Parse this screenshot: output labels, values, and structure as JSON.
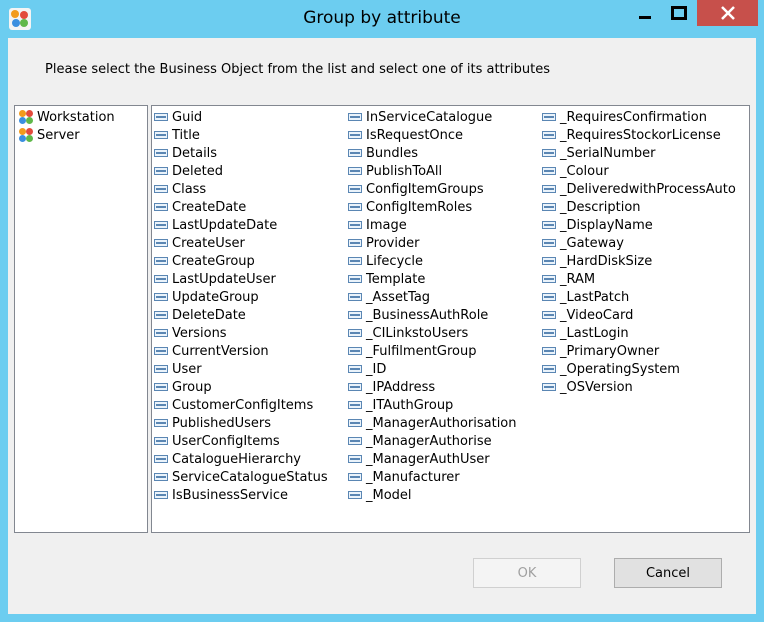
{
  "window": {
    "title": "Group by attribute",
    "colors": {
      "titlebar": "#6ccdf0",
      "close": "#c7504b"
    }
  },
  "instruction": "Please select the Business Object from the list and select one of its attributes",
  "business_objects": [
    {
      "label": "Workstation",
      "icon": "business-object-icon"
    },
    {
      "label": "Server",
      "icon": "business-object-icon"
    }
  ],
  "attributes": {
    "col1": [
      "Guid",
      "Title",
      "Details",
      "Deleted",
      "Class",
      "CreateDate",
      "LastUpdateDate",
      "CreateUser",
      "CreateGroup",
      "LastUpdateUser",
      "UpdateGroup",
      "DeleteDate",
      "Versions",
      "CurrentVersion",
      "User",
      "Group",
      "CustomerConfigItems",
      "PublishedUsers",
      "UserConfigItems",
      "CatalogueHierarchy",
      "ServiceCatalogueStatus",
      "IsBusinessService"
    ],
    "col2": [
      "InServiceCatalogue",
      "IsRequestOnce",
      "Bundles",
      "PublishToAll",
      "ConfigItemGroups",
      "ConfigItemRoles",
      "Image",
      "Provider",
      "Lifecycle",
      "Template",
      "_AssetTag",
      "_BusinessAuthRole",
      "_CILinkstoUsers",
      "_FulfilmentGroup",
      "_ID",
      "_IPAddress",
      "_ITAuthGroup",
      "_ManagerAuthorisation",
      "_ManagerAuthorise",
      "_ManagerAuthUser",
      "_Manufacturer",
      "_Model"
    ],
    "col3": [
      "_RequiresConfirmation",
      "_RequiresStockorLicense",
      "_SerialNumber",
      "_Colour",
      "_DeliveredwithProcessAuto",
      "_Description",
      "_DisplayName",
      "_Gateway",
      "_HardDiskSize",
      "_RAM",
      "_LastPatch",
      "_VideoCard",
      "_LastLogin",
      "_PrimaryOwner",
      "_OperatingSystem",
      "_OSVersion"
    ]
  },
  "buttons": {
    "ok": "OK",
    "cancel": "Cancel"
  }
}
